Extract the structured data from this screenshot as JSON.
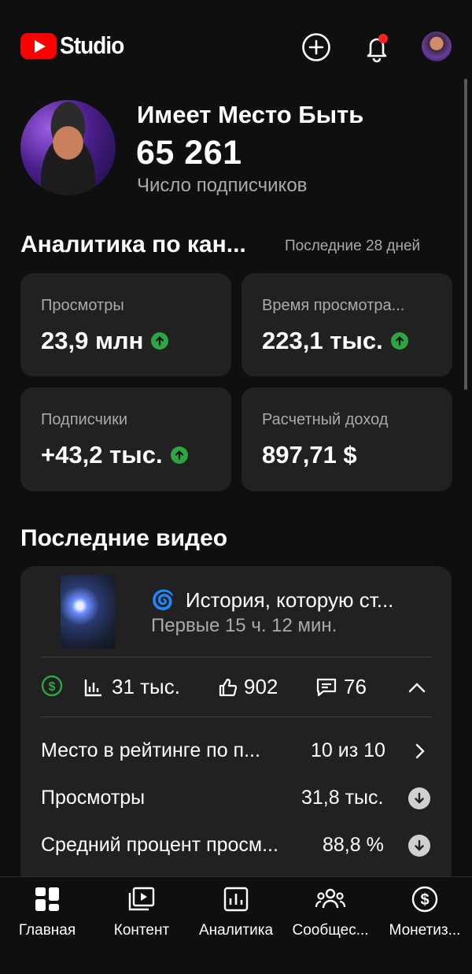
{
  "header": {
    "logo_text": "Studio",
    "create_icon": "plus-circle-icon",
    "notifications_icon": "bell-icon",
    "notification_dot_color": "#ff0000"
  },
  "channel": {
    "name": "Имеет Место Быть",
    "subscribers": "65 261",
    "subscribers_label": "Число подписчиков"
  },
  "analytics": {
    "title": "Аналитика по кан...",
    "period": "Последние 28 дней",
    "cards": [
      {
        "label": "Просмотры",
        "value": "23,9 млн",
        "trend": "up"
      },
      {
        "label": "Время просмотра...",
        "value": "223,1 тыс.",
        "trend": "up"
      },
      {
        "label": "Подписчики",
        "value": "+43,2 тыс.",
        "trend": "up"
      },
      {
        "label": "Расчетный доход",
        "value": "897,71 $",
        "trend": "none"
      }
    ]
  },
  "recent_videos": {
    "title": "Последние видео",
    "video": {
      "emoji": "🌀",
      "title": "История, которую ст...",
      "age": "Первые 15 ч. 12 мин.",
      "views": "31 тыс.",
      "likes": "902",
      "comments": "76",
      "rows": [
        {
          "label": "Место в рейтинге по п...",
          "value": "10 из 10"
        },
        {
          "label": "Просмотры",
          "value": "31,8 тыс."
        },
        {
          "label": "Средний процент просм...",
          "value": "88,8 %"
        }
      ]
    }
  },
  "nav": [
    {
      "label": "Главная",
      "icon": "dashboard-icon"
    },
    {
      "label": "Контент",
      "icon": "content-icon"
    },
    {
      "label": "Аналитика",
      "icon": "analytics-icon"
    },
    {
      "label": "Сообщес...",
      "icon": "community-icon"
    },
    {
      "label": "Монетиз...",
      "icon": "monetization-icon"
    }
  ],
  "colors": {
    "background": "#0f0f0f",
    "card": "#212121",
    "accent_red": "#ff0000",
    "trend_green": "#2ba640",
    "monetization_green": "#2ba640"
  }
}
